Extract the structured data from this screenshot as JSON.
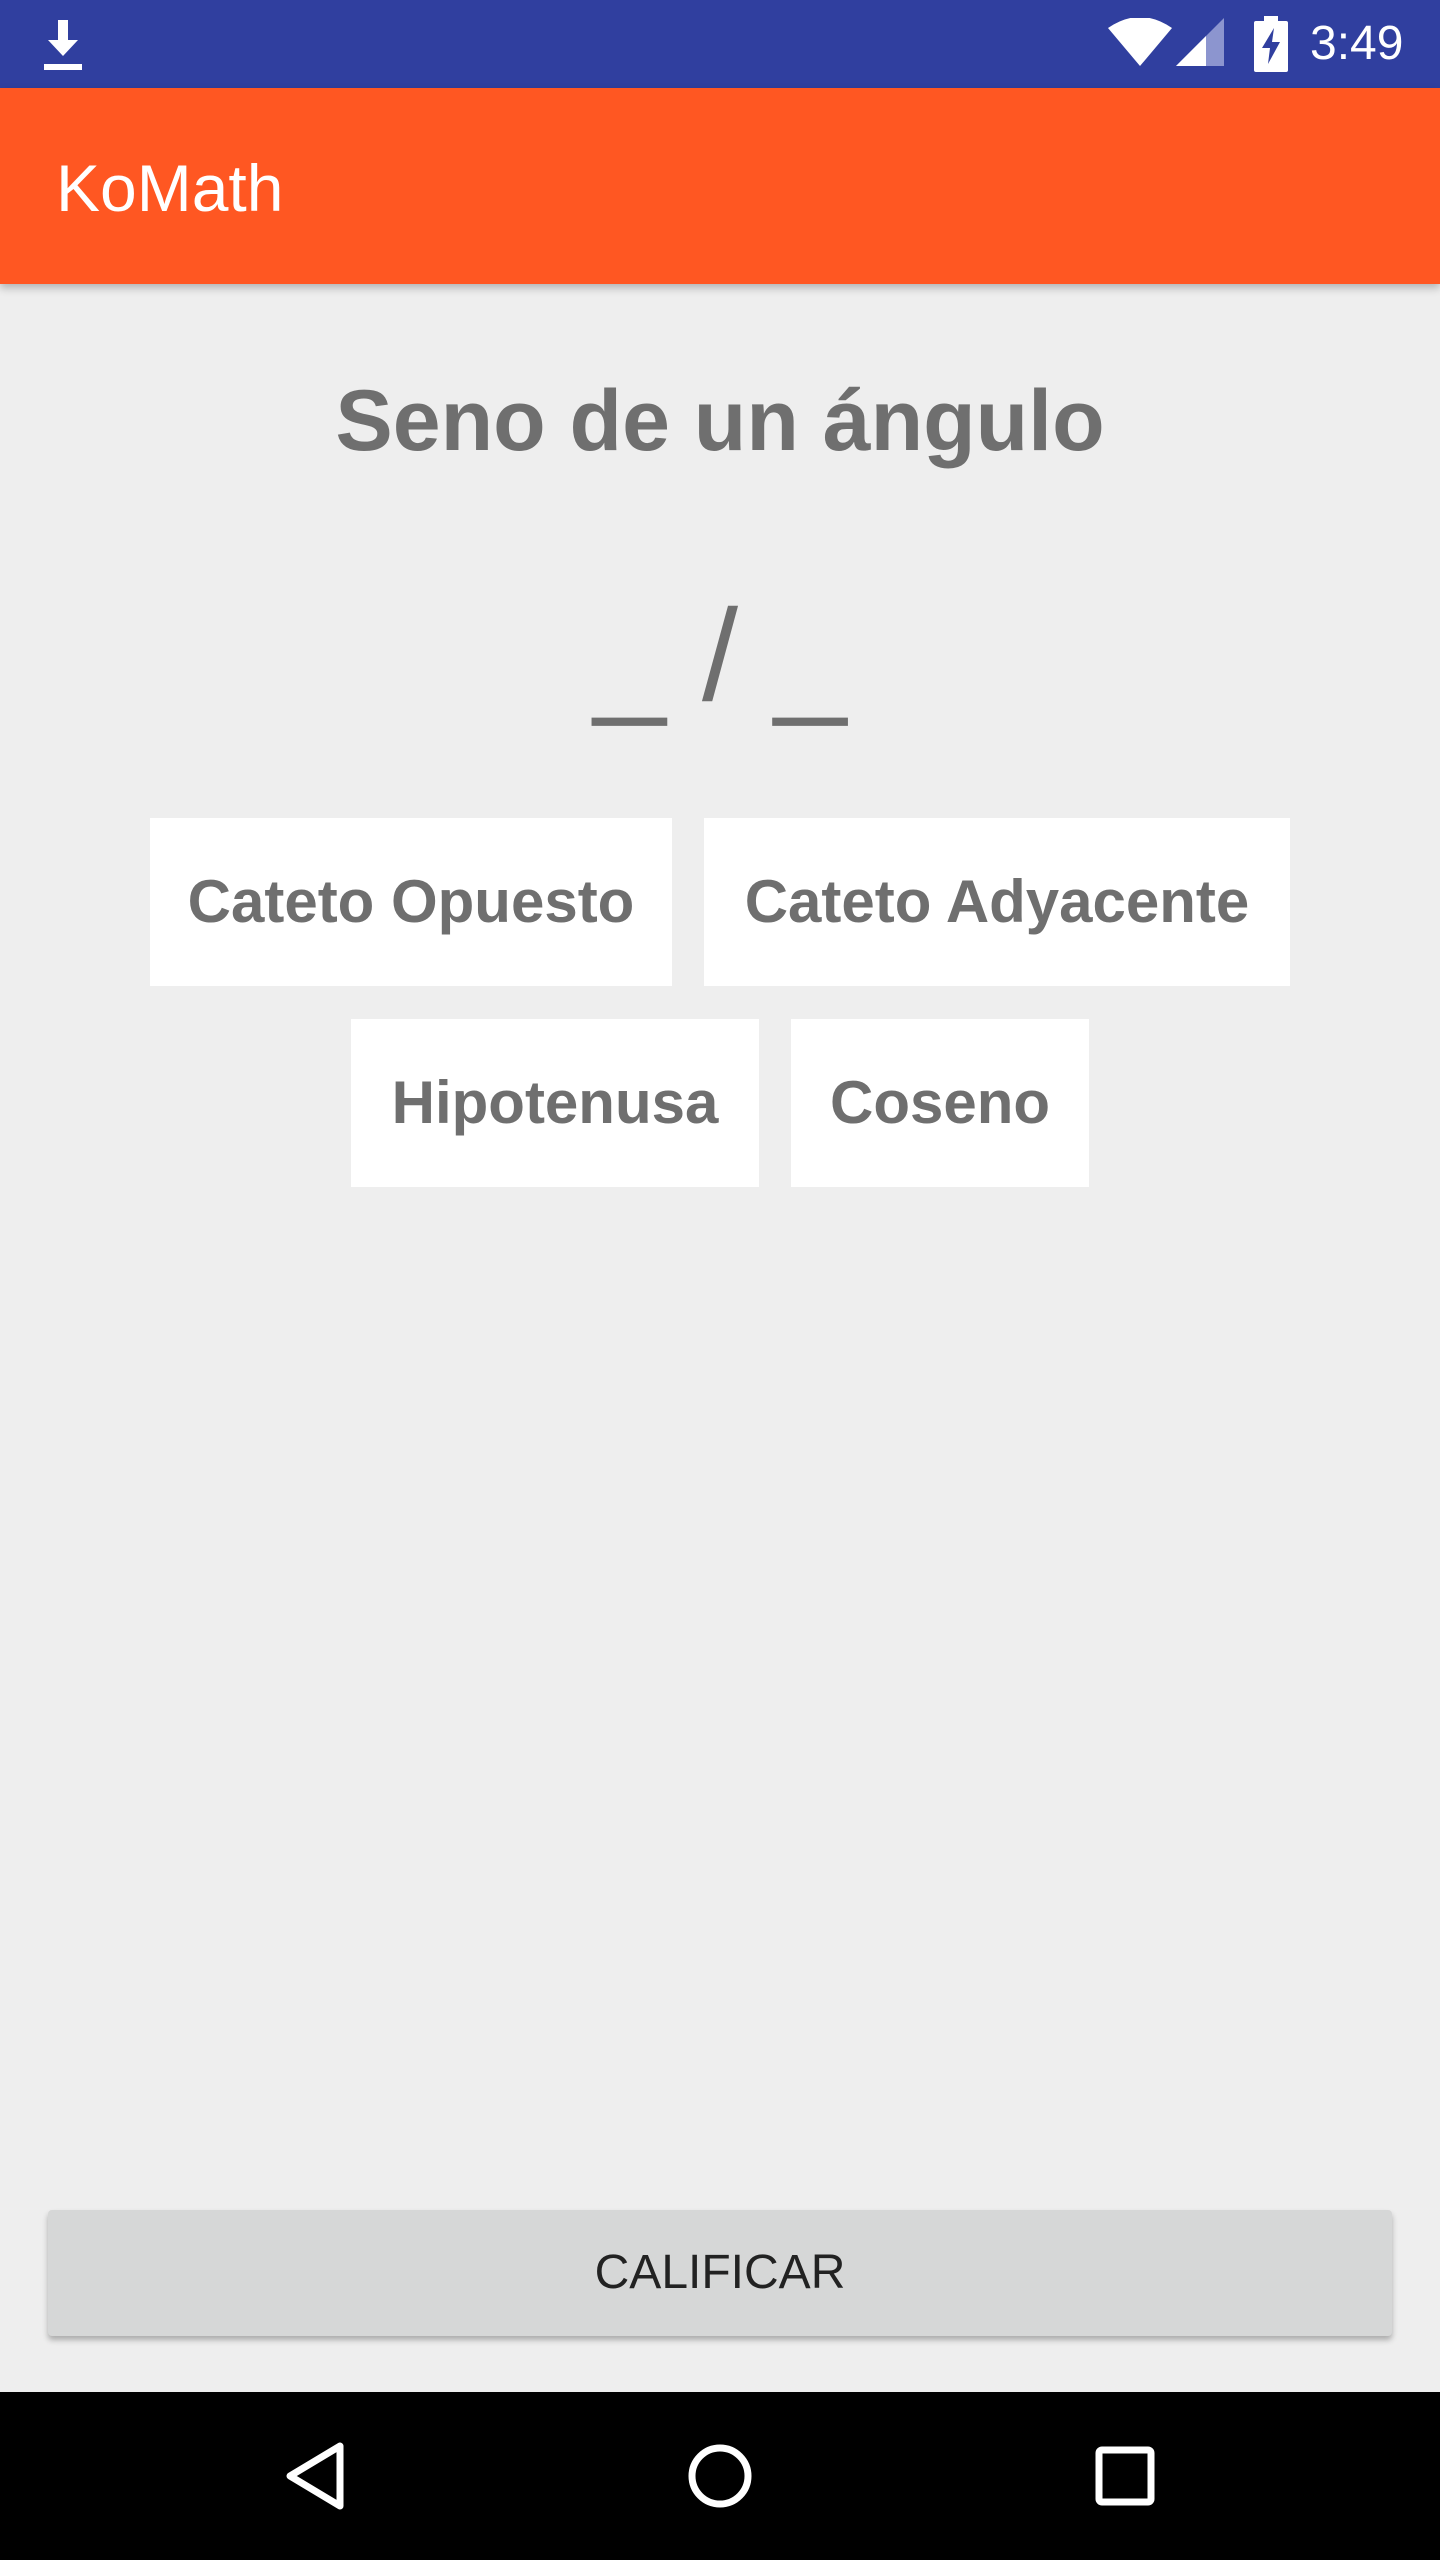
{
  "status_bar": {
    "time": "3:49",
    "icons": [
      "download-icon",
      "wifi-icon",
      "cell-signal-icon",
      "battery-charging-icon"
    ]
  },
  "app_bar": {
    "title": "KoMath"
  },
  "main": {
    "title": "Seno de un ángulo",
    "answer_slots": "_ / _",
    "options": [
      "Cateto Opuesto",
      "Cateto Adyacente",
      "Hipotenusa",
      "Coseno"
    ]
  },
  "grade_button": {
    "label": "CALIFICAR"
  },
  "nav_bar": {
    "icons": [
      "back-icon",
      "home-icon",
      "recents-icon"
    ]
  },
  "colors": {
    "status_bar": "#303f9f",
    "app_bar": "#ff5722",
    "background": "#eeeeee",
    "text_gray": "#6f6f6f",
    "button_gray": "#d6d7d7"
  }
}
